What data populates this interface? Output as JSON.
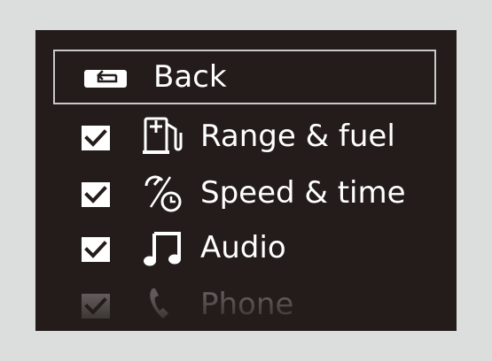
{
  "menu": {
    "back_label": "Back",
    "items": [
      {
        "label": "Range & fuel",
        "checked": true,
        "icon": "fuel-pump-icon"
      },
      {
        "label": "Speed & time",
        "checked": true,
        "icon": "speed-time-icon"
      },
      {
        "label": "Audio",
        "checked": true,
        "icon": "music-note-icon"
      },
      {
        "label": "Phone",
        "checked": true,
        "icon": "phone-icon"
      }
    ]
  },
  "colors": {
    "screen_background": "#231c1a",
    "frame_background": "#dcdedd",
    "text": "#ffffff",
    "selection_border": "#c9c9c9"
  }
}
